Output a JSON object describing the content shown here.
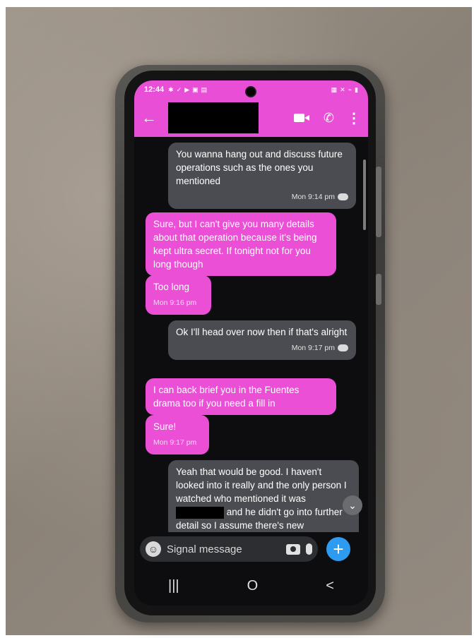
{
  "status_bar": {
    "time": "12:44",
    "left_icons": [
      "settings-icon",
      "location-icon",
      "play-icon",
      "gallery-icon",
      "card-icon"
    ],
    "right_icons": [
      "calendar-icon",
      "mute-icon",
      "wifi-icon",
      "battery-icon"
    ]
  },
  "header": {
    "contact_name_redacted": true
  },
  "messages": [
    {
      "direction": "outgoing",
      "text": "You wanna hang out and discuss future operations such as the ones you mentioned",
      "timestamp": "Mon 9:14 pm",
      "read": true
    },
    {
      "direction": "incoming",
      "text": "Sure, but I can't give you many details about that operation because it's being kept ultra secret. If tonight not for you long though"
    },
    {
      "direction": "incoming",
      "text": "Too long",
      "timestamp": "Mon 9:16 pm"
    },
    {
      "direction": "outgoing",
      "text": "Ok I'll head over now then if that's alright",
      "timestamp": "Mon 9:17 pm",
      "read": true
    },
    {
      "direction": "incoming",
      "text": "I can back brief you in the Fuentes drama too if you need a fill in"
    },
    {
      "direction": "incoming",
      "text": "Sure!",
      "timestamp": "Mon 9:17 pm"
    },
    {
      "direction": "outgoing",
      "text_before": "Yeah that would be good. I haven't looked into it really and the only person I watched who mentioned it was",
      "text_after": "and he didn't go into further detail so I assume there's new"
    }
  ],
  "composer": {
    "placeholder": "Signal message"
  },
  "colors": {
    "accent": "#e94fd6",
    "outgoing_bubble": "#4a4c51",
    "incoming_bubble": "#ea4fd6",
    "send_button": "#2d9cf0"
  },
  "nav": {
    "recents": "|||",
    "home": "O",
    "back": "<"
  }
}
